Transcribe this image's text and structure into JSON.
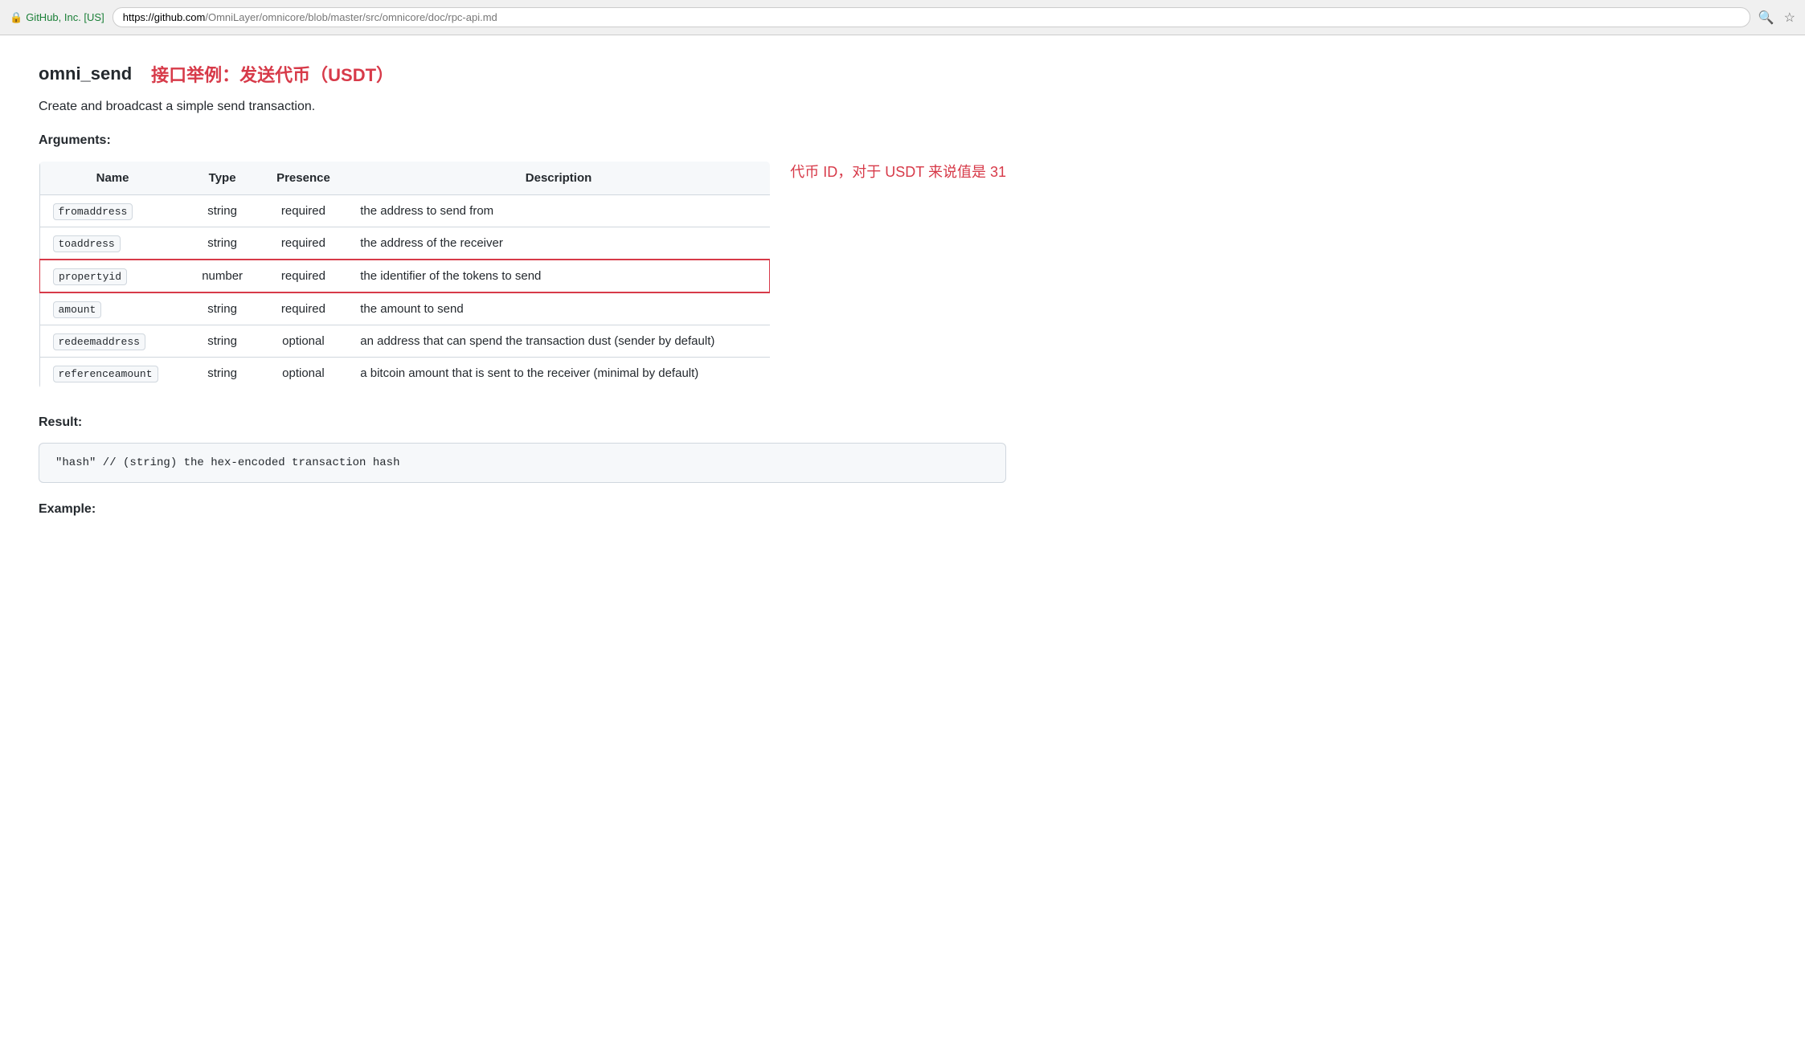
{
  "browser": {
    "lock_label": "GitHub, Inc. [US]",
    "url_origin": "https://github.com",
    "url_path": "/OmniLayer/omnicore/blob/master/src/omnicore/doc/rpc-api.md"
  },
  "page": {
    "title": "omni_send",
    "subtitle": "接口举例：发送代币（USDT）",
    "description": "Create and broadcast a simple send transaction.",
    "arguments_label": "Arguments:",
    "result_label": "Result:",
    "example_label": "Example:",
    "table": {
      "headers": [
        "Name",
        "Type",
        "Presence",
        "Description"
      ],
      "rows": [
        {
          "name": "fromaddress",
          "type": "string",
          "presence": "required",
          "description": "the address to send from",
          "highlighted": false
        },
        {
          "name": "toaddress",
          "type": "string",
          "presence": "required",
          "description": "the address of the receiver",
          "highlighted": false
        },
        {
          "name": "propertyid",
          "type": "number",
          "presence": "required",
          "description": "the identifier of the tokens to send",
          "highlighted": true,
          "annotation": "代币 ID，对于 USDT 来说值是 31"
        },
        {
          "name": "amount",
          "type": "string",
          "presence": "required",
          "description": "the amount to send",
          "highlighted": false
        },
        {
          "name": "redeemaddress",
          "type": "string",
          "presence": "optional",
          "description": "an address that can spend the transaction dust (sender by default)",
          "highlighted": false
        },
        {
          "name": "referenceamount",
          "type": "string",
          "presence": "optional",
          "description": "a bitcoin amount that is sent to the receiver (minimal by default)",
          "highlighted": false
        }
      ]
    },
    "code_block": "\"hash\"  // (string) the hex-encoded transaction hash"
  }
}
